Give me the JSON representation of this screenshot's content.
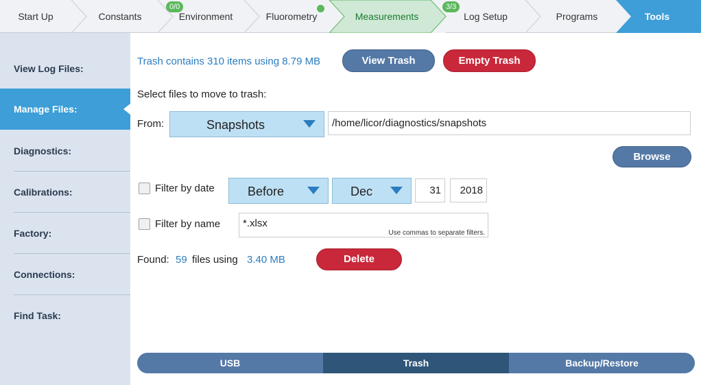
{
  "nav": {
    "steps": [
      {
        "label": "Start Up"
      },
      {
        "label": "Constants"
      },
      {
        "label": "Environment",
        "badge": "0/0"
      },
      {
        "label": "Fluorometry"
      },
      {
        "label": "Measurements"
      },
      {
        "label": "Log Setup",
        "badge": "3/3"
      },
      {
        "label": "Programs"
      },
      {
        "label": "Tools"
      }
    ],
    "active_step": "Measurements",
    "current_step": "Tools"
  },
  "sidebar": {
    "items": [
      {
        "label": "View Log Files:"
      },
      {
        "label": "Manage Files:"
      },
      {
        "label": "Diagnostics:"
      },
      {
        "label": "Calibrations:"
      },
      {
        "label": "Factory:"
      },
      {
        "label": "Connections:"
      },
      {
        "label": "Find Task:"
      }
    ],
    "selected": "Manage Files:"
  },
  "trash": {
    "status": "Trash contains 310 items using 8.79 MB",
    "view_label": "View Trash",
    "empty_label": "Empty Trash"
  },
  "select": {
    "heading": "Select files to move to trash:",
    "from_label": "From:",
    "source": "Snapshots",
    "path": "/home/licor/diagnostics/snapshots",
    "browse_label": "Browse"
  },
  "filter_date": {
    "label": "Filter by date",
    "checked": false,
    "relation": "Before",
    "month": "Dec",
    "day": "31",
    "year": "2018"
  },
  "filter_name": {
    "label": "Filter by name",
    "checked": false,
    "value": "*.xlsx",
    "hint": "Use commas to separate filters."
  },
  "found": {
    "prefix": "Found:",
    "count": "59",
    "middle": "files using",
    "size": "3.40 MB",
    "delete_label": "Delete"
  },
  "tabs": {
    "items": [
      {
        "label": "USB"
      },
      {
        "label": "Trash"
      },
      {
        "label": "Backup/Restore"
      }
    ],
    "selected": "Trash"
  },
  "colors": {
    "accent_blue": "#3d9ed8",
    "link_blue": "#2b7cc0",
    "slate_button": "#5479a6",
    "danger_red": "#c9283a",
    "success_green": "#5bb85c",
    "sidebar_bg": "#dbe3ef"
  }
}
